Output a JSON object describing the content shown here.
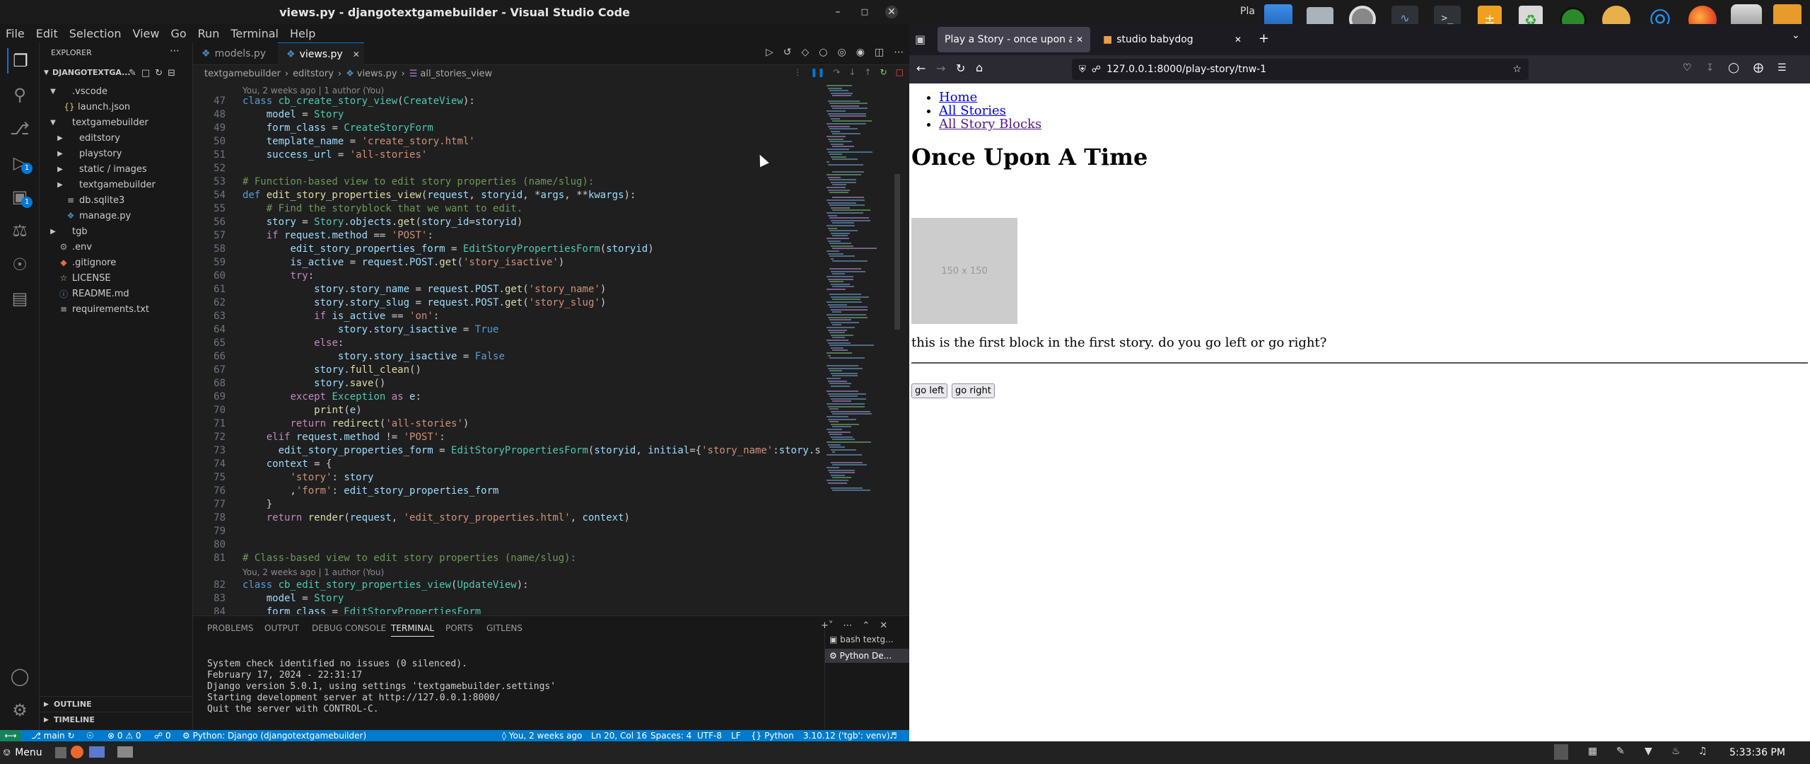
{
  "vscode": {
    "title": "views.py - djangotextgamebuilder - Visual Studio Code",
    "menu": [
      "File",
      "Edit",
      "Selection",
      "View",
      "Go",
      "Run",
      "Terminal",
      "Help"
    ],
    "explorer": {
      "header": "EXPLORER",
      "root": "DJANGOTEXTGA...",
      "items": [
        {
          "label": ".vscode",
          "kind": "folder-open"
        },
        {
          "label": "launch.json",
          "kind": "json"
        },
        {
          "label": "textgamebuilder",
          "kind": "folder-open"
        },
        {
          "label": "editstory",
          "kind": "folder"
        },
        {
          "label": "playstory",
          "kind": "folder"
        },
        {
          "label": "static / images",
          "kind": "folder"
        },
        {
          "label": "textgamebuilder",
          "kind": "folder"
        },
        {
          "label": "db.sqlite3",
          "kind": "db"
        },
        {
          "label": "manage.py",
          "kind": "py"
        },
        {
          "label": "tgb",
          "kind": "folder"
        },
        {
          "label": ".env",
          "kind": "gear"
        },
        {
          "label": ".gitignore",
          "kind": "git"
        },
        {
          "label": "LICENSE",
          "kind": "license"
        },
        {
          "label": "README.md",
          "kind": "md"
        },
        {
          "label": "requirements.txt",
          "kind": "txt"
        }
      ],
      "outline": "OUTLINE",
      "timeline": "TIMELINE"
    },
    "tabs": [
      {
        "label": "models.py",
        "active": false
      },
      {
        "label": "views.py",
        "active": true
      }
    ],
    "breadcrumb": [
      "textgamebuilder",
      "editstory",
      "views.py",
      "all_stories_view"
    ],
    "blame_top": "You, 2 weeks ago | 1 author (You)",
    "blame_bottom": "You, 2 weeks ago | 1 author (You)",
    "line_numbers": [
      "47",
      "48",
      "49",
      "50",
      "51",
      "52",
      "53",
      "54",
      "55",
      "56",
      "57",
      "58",
      "59",
      "60",
      "61",
      "62",
      "63",
      "64",
      "65",
      "66",
      "67",
      "68",
      "69",
      "70",
      "71",
      "72",
      "73",
      "74",
      "75",
      "76",
      "77",
      "78",
      "79",
      "80",
      "81",
      "82",
      "83",
      "84"
    ],
    "panel": {
      "tabs": [
        "PROBLEMS",
        "OUTPUT",
        "DEBUG CONSOLE",
        "TERMINAL",
        "PORTS",
        "GITLENS"
      ],
      "terminal_lines": [
        "System check identified no issues (0 silenced).",
        "February 17, 2024 - 22:31:17",
        "Django version 5.0.1, using settings 'textgamebuilder.settings'",
        "Starting development server at http://127.0.0.1:8000/",
        "Quit the server with CONTROL-C."
      ],
      "terminals": [
        "bash textg...",
        "Python De..."
      ]
    },
    "status": {
      "branch": "main",
      "problems": "0 ⚠ 0",
      "ports": "0",
      "interpreter": "Python: Django (djangotextgamebuilder)",
      "blame": "You, 2 weeks ago",
      "position": "Ln 20, Col 16",
      "spaces": "Spaces: 4",
      "encoding": "UTF-8",
      "eol": "LF",
      "language": "Python",
      "version": "3.10.12 ('tgb': venv)"
    }
  },
  "browser": {
    "tabs": [
      {
        "label": "Play a Story - once upon a tim",
        "active": true
      },
      {
        "label": "studio babydog",
        "active": false
      }
    ],
    "url": "127.0.0.1:8000/play-story/tnw-1",
    "page": {
      "links": [
        "Home",
        "All Stories",
        "All Story Blocks"
      ],
      "heading": "Once Upon A Time",
      "image_placeholder": "150 x 150",
      "body": "this is the first block in the first story. do you go left or go right?",
      "buttons": [
        "go left",
        "go right"
      ]
    }
  },
  "system": {
    "top_right": "Pla",
    "taskbar_menu": "Menu",
    "clock": "5:33:36 PM"
  }
}
